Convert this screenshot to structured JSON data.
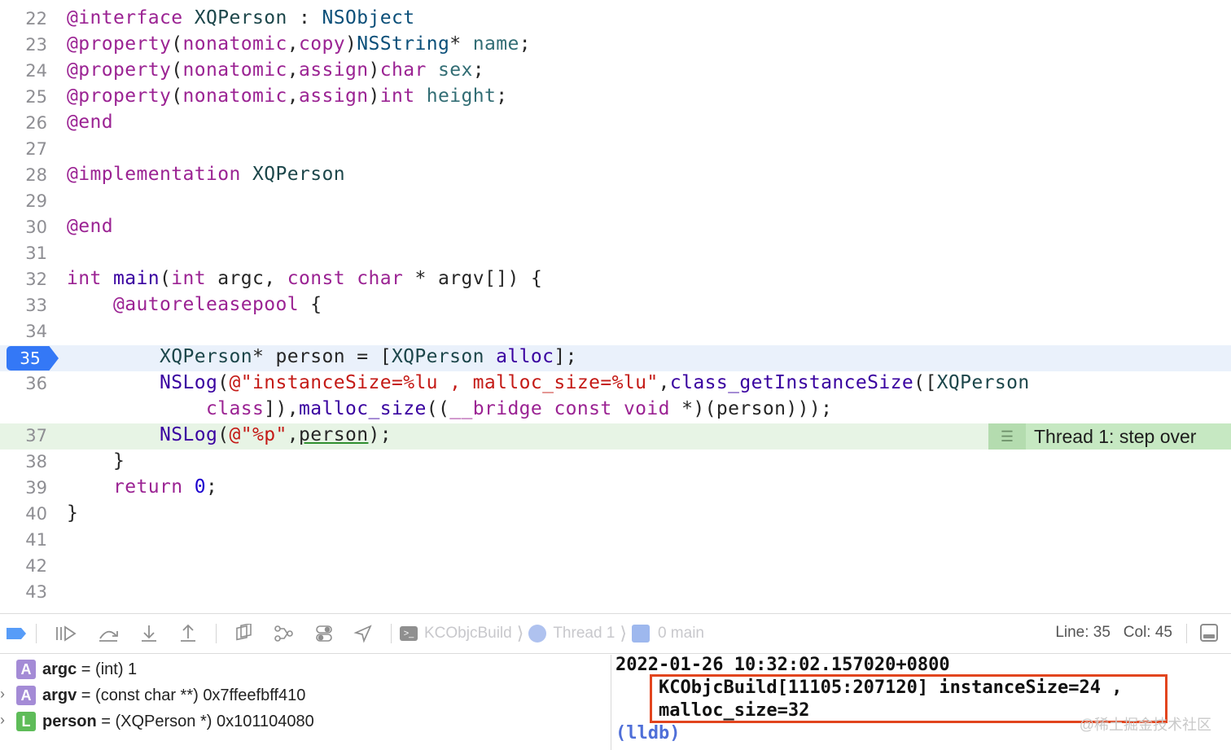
{
  "editor": {
    "lines": [
      {
        "num": "22"
      },
      {
        "num": "23"
      },
      {
        "num": "24"
      },
      {
        "num": "25"
      },
      {
        "num": "26"
      },
      {
        "num": "27"
      },
      {
        "num": "28"
      },
      {
        "num": "29"
      },
      {
        "num": "30"
      },
      {
        "num": "31"
      },
      {
        "num": "32"
      },
      {
        "num": "33"
      },
      {
        "num": "34"
      },
      {
        "num": "35"
      },
      {
        "num": "36"
      },
      {
        "num": ""
      },
      {
        "num": "37"
      },
      {
        "num": "38"
      },
      {
        "num": "39"
      },
      {
        "num": "40"
      },
      {
        "num": "41"
      },
      {
        "num": "42"
      },
      {
        "num": "43"
      }
    ],
    "breakpoint_line": "35",
    "thread_badge": "Thread 1: step over",
    "colors": {
      "breakpoint": "#3478f6",
      "current_line": "#e7f4e5",
      "breakpoint_line_bg": "#eaf1fb"
    }
  },
  "toolbar": {
    "breadcrumbs": [
      "KCObjcBuild",
      "Thread 1",
      "0 main"
    ],
    "line_label": "Line: 35",
    "col_label": "Col: 45",
    "icons": [
      "breakpoints-toggle-icon",
      "continue-icon",
      "step-over-icon",
      "step-into-icon",
      "step-out-icon",
      "debug-view-hierarchy-icon",
      "memory-graph-icon",
      "environment-overrides-icon",
      "simulate-location-icon"
    ]
  },
  "variables": [
    {
      "kind": "A",
      "name": "argc",
      "eq": " = ",
      "value": "(int) 1",
      "expandable": false
    },
    {
      "kind": "A",
      "name": "argv",
      "eq": " = ",
      "value": "(const char **) 0x7ffeefbff410",
      "expandable": true
    },
    {
      "kind": "L",
      "name": "person",
      "eq": " = ",
      "value": "(XQPerson *) 0x101104080",
      "expandable": true
    }
  ],
  "console": {
    "line1": "2022-01-26 10:32:02.157020+0800",
    "line2": "    KCObjcBuild[11105:207120] instanceSize=24 ,",
    "line3": "    malloc_size=32",
    "prompt": "(lldb)",
    "highlight_color": "#e2451e"
  },
  "watermark": "@稀土掘金技术社区"
}
